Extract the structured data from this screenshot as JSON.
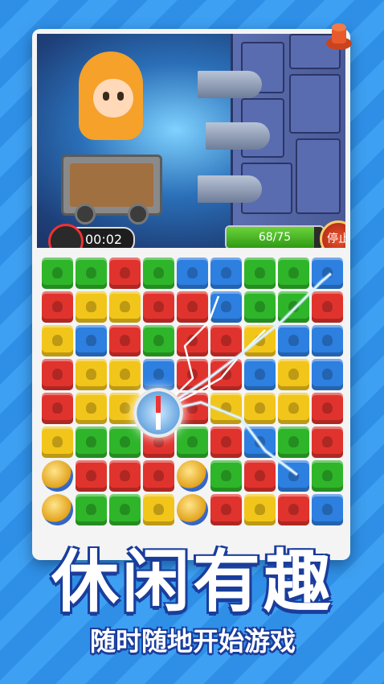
{
  "hud": {
    "timer": "00:02",
    "progress_text": "68/75",
    "progress_fraction": 0.9067,
    "stop_label": "停止"
  },
  "colors": {
    "green": "#2fb52a",
    "red": "#e1332d",
    "yellow": "#f2c51a",
    "blue": "#2d7fe0",
    "headline_outline": "#1a3d9c"
  },
  "board": [
    [
      "g",
      "g",
      "r",
      "g",
      "b",
      "b",
      "g",
      "g",
      "b"
    ],
    [
      "r",
      "y",
      "y",
      "r",
      "r",
      "b",
      "g",
      "g",
      "r"
    ],
    [
      "y",
      "b",
      "r",
      "g",
      "r",
      "r",
      "y",
      "b",
      "b"
    ],
    [
      "r",
      "y",
      "y",
      "b",
      "r",
      "r",
      "b",
      "y",
      "b"
    ],
    [
      "r",
      "y",
      "y",
      "g",
      "r",
      "y",
      "y",
      "y",
      "r"
    ],
    [
      "y",
      "g",
      "g",
      "r",
      "g",
      "r",
      "b",
      "g",
      "r"
    ],
    [
      "ball",
      "r",
      "r",
      "r",
      "ball",
      "g",
      "r",
      "b",
      "g"
    ],
    [
      "ball",
      "g",
      "g",
      "y",
      "ball",
      "r",
      "y",
      "r",
      "b"
    ]
  ],
  "headline": "休闲有趣",
  "subline": "随时随地开始游戏"
}
